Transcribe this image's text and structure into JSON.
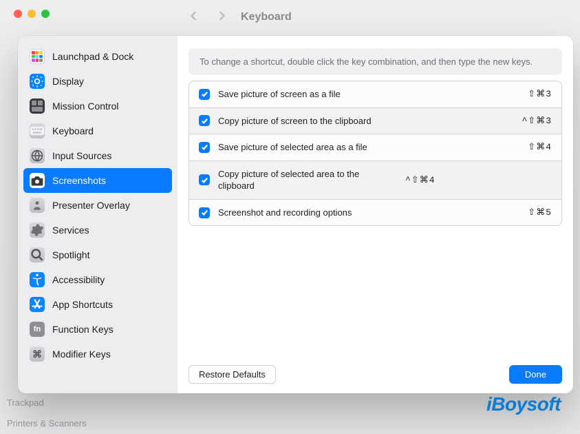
{
  "underlay": {
    "title": "Keyboard",
    "bg_items": [
      "Trackpad",
      "Printers & Scanners"
    ]
  },
  "sidebar": {
    "items": [
      {
        "label": "Launchpad & Dock",
        "icon": "grid"
      },
      {
        "label": "Display",
        "icon": "brightness"
      },
      {
        "label": "Mission Control",
        "icon": "mission"
      },
      {
        "label": "Keyboard",
        "icon": "keyboard"
      },
      {
        "label": "Input Sources",
        "icon": "globe"
      },
      {
        "label": "Screenshots",
        "icon": "camera",
        "selected": true
      },
      {
        "label": "Presenter Overlay",
        "icon": "overlay"
      },
      {
        "label": "Services",
        "icon": "gear"
      },
      {
        "label": "Spotlight",
        "icon": "search"
      },
      {
        "label": "Accessibility",
        "icon": "accessibility"
      },
      {
        "label": "App Shortcuts",
        "icon": "appstore"
      },
      {
        "label": "Function Keys",
        "icon": "fn"
      },
      {
        "label": "Modifier Keys",
        "icon": "modifier"
      }
    ]
  },
  "content": {
    "hint": "To change a shortcut, double click the key combination, and then type the new keys.",
    "shortcuts": [
      {
        "label": "Save picture of screen as a file",
        "keys": "⇧⌘3",
        "checked": true
      },
      {
        "label": "Copy picture of screen to the clipboard",
        "keys": "^⇧⌘3",
        "checked": true
      },
      {
        "label": "Save picture of selected area as a file",
        "keys": "⇧⌘4",
        "checked": true
      },
      {
        "label": "Copy picture of selected area to the clipboard",
        "keys": "^⇧⌘4",
        "checked": true
      },
      {
        "label": "Screenshot and recording options",
        "keys": "⇧⌘5",
        "checked": true
      }
    ],
    "restore_label": "Restore Defaults",
    "done_label": "Done"
  },
  "watermark": "iBoysoft"
}
